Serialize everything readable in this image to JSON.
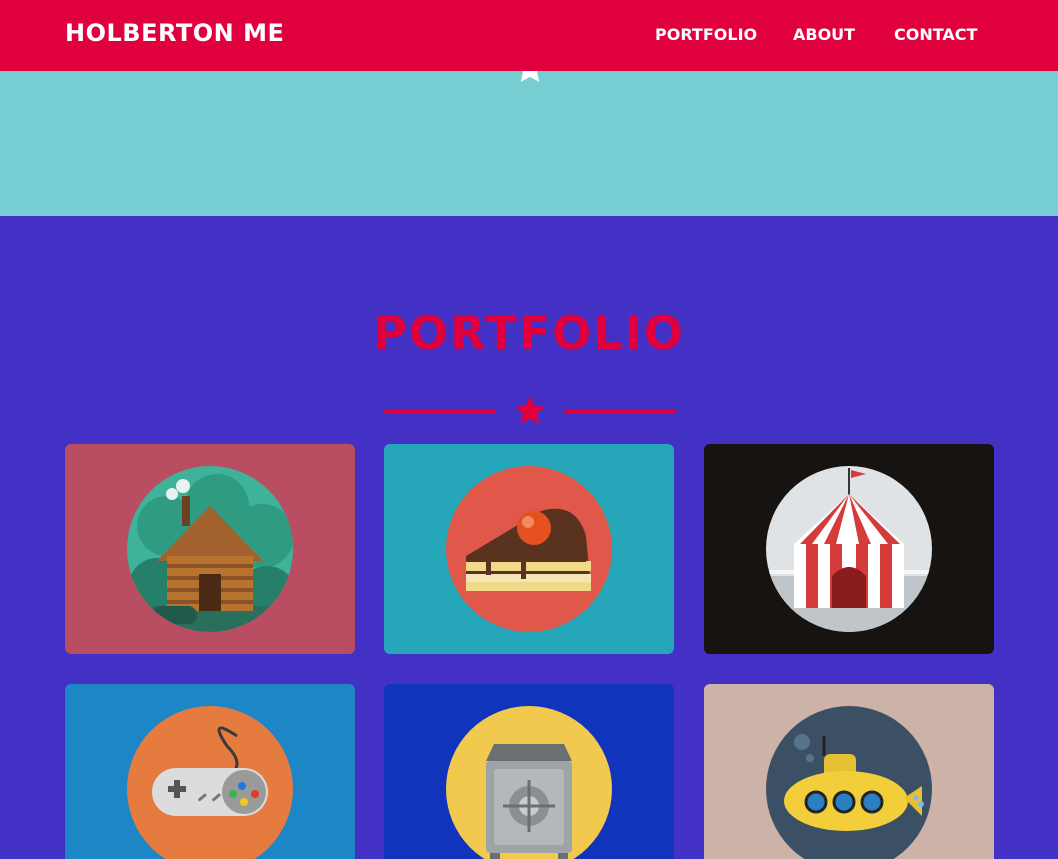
{
  "navbar": {
    "brand": "HOLBERTON ME",
    "links": [
      {
        "label": "PORTFOLIO"
      },
      {
        "label": "ABOUT"
      },
      {
        "label": "CONTACT"
      }
    ],
    "background": "#e1003e"
  },
  "hero": {
    "background": "#77ced3",
    "divider_color": "#ffffff"
  },
  "portfolio": {
    "title": "PORTFOLIO",
    "background": "#4231c4",
    "accent": "#e1003e",
    "items": [
      {
        "name": "cabin",
        "icon": "cabin-icon",
        "background": "#b94d62"
      },
      {
        "name": "cake",
        "icon": "cake-icon",
        "background": "#25a6b9"
      },
      {
        "name": "circus",
        "icon": "circus-tent-icon",
        "background": "#161311"
      },
      {
        "name": "game",
        "icon": "game-controller-icon",
        "background": "#1c86c7"
      },
      {
        "name": "safe",
        "icon": "safe-icon",
        "background": "#1034bb"
      },
      {
        "name": "submarine",
        "icon": "submarine-icon",
        "background": "#ccb2a7"
      }
    ]
  }
}
